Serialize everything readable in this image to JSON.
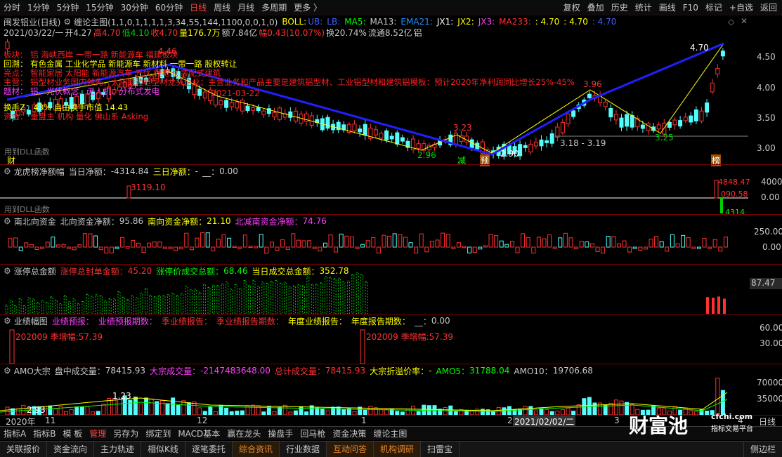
{
  "toolbar": {
    "periods": [
      "分时",
      "1分钟",
      "5分钟",
      "15分钟",
      "30分钟",
      "60分钟",
      "日线",
      "周线",
      "月线",
      "多周期",
      "更多 〉"
    ],
    "active_period": "日线",
    "right_items": [
      "复权",
      "叠加",
      "历史",
      "统计",
      "画线",
      "F10",
      "标记",
      "+自选",
      "返回"
    ]
  },
  "main": {
    "stock_title": "闽发铝业(日线)",
    "indicator": "缠论主图(1,1,0,1,1,1,1,3,34,55,144,1100,0,0,1,0)",
    "boll": "BOLL:",
    "ub": "UB:",
    "lb": "LB:",
    "ma5": "MA5:",
    "ma13": "MA13:",
    "ema21": "EMA21:",
    "jx1": "JX1:",
    "jx2": "JX2:",
    "jx3": "JX3:",
    "ma233": "MA233:",
    "val1": ": 4.70",
    "val2": ": 4.70",
    "val3": ": 4.70",
    "ohlc": {
      "date": "2021/03/22/一",
      "open": "开4.27",
      "high": "高4.70",
      "low": "低4.10",
      "close": "收4.70",
      "volume": "量176.7万",
      "amount": "额7.84亿",
      "amplitude": "幅0.43(10.07%)",
      "turnover": "换20.74%",
      "float": "流通8.52亿",
      "tag": "铝"
    },
    "overlay_lines": [
      "板块：  铝      海峡西岸      一带一路  新能源车  福建板块",
      "回溯：  有色金属  工业化学品  新能源车  新材料  一带一路  股权转让",
      "亮点：  智能家居  太阳能  新能源汽车  光伏  锂电池  装配式建筑",
      "主营：  铝型材业务国内领先，太阳能边框型材龙头企业；主营业务和产品主要是建筑铝型材、工业铝型材和建筑铝模板：预计2020年净利润同比增长25%-45%",
      "题材：  铝、光伏概念、无人机、分布式发电",
      "换手Z：43%  自由换手市值  14.43",
      "资金：  量盘主  机构  量化  佛山系  Asking"
    ],
    "annotation_date": "2021-03-22",
    "y_ticks": [
      "4.50",
      "4.00",
      "3.50",
      "3.00"
    ],
    "price_labels": [
      "4.70",
      "3.96",
      "3.23",
      "2.96",
      "2.90",
      "3.18 - 3.19",
      "3.25",
      "4.46"
    ],
    "markers": [
      "财",
      "减",
      "预",
      "榜"
    ],
    "dll_label": "用到DLL函数"
  },
  "panels": {
    "longhu": {
      "title": "龙虎榜净额幅",
      "l1": "当日净额：",
      "v1": "-4314.84",
      "l2": "三日净额：",
      "v2": "-",
      "l3": "__：",
      "v3": "0.00",
      "y_ticks": [
        "4000",
        "0.00"
      ],
      "labels": [
        "3119.10",
        "4848.47",
        "090.58",
        "4314."
      ]
    },
    "northbound": {
      "title": "南北向资金",
      "l1": "北向资金净额：",
      "v1": "95.86",
      "l2": "南向资金净额：",
      "v2": "21.10",
      "l3": "北减南资金净额：",
      "v3": "74.76",
      "y_ticks": [
        "250.00",
        "0.00"
      ]
    },
    "limitup": {
      "title": "涨停总金额",
      "l1": "涨停总封单金额：",
      "v1": "45.20",
      "l2": "涨停价成交总额：",
      "v2": "68.46",
      "l3": "当日成交总金额：",
      "v3": "352.78",
      "y_tick": "87.47"
    },
    "earnings": {
      "title": "业绩幅图",
      "l1": "业绩预报：",
      "l2": "业绩预报期数：",
      "l3": "季业绩报告：",
      "l4": "季业绩报告期数：",
      "l5": "年度业绩报告：",
      "l6": "年度报告期数：",
      "l7": "__：",
      "v7": "0.00",
      "y_ticks": [
        "60.00",
        "30.00"
      ],
      "labels": [
        "202009  季增幅:57.39",
        "202009  季增幅:57.39"
      ]
    },
    "amo": {
      "title": "AMO大宗",
      "l1": "盘中成交量：",
      "v1": "78415.93",
      "l2": "大宗成交量：",
      "v2": "-2147483648.00",
      "l3": "总计成交量：",
      "v3": "78415.93",
      "l4": "大宗折溢价率：",
      "v4": "-",
      "l5": "AMO5：",
      "v5": "31788.04",
      "l6": "AMO10：",
      "v6": "19706.68",
      "y_ticks": [
        "70000",
        "35000"
      ],
      "labels": [
        "1.23",
        "2.93"
      ]
    }
  },
  "xaxis": {
    "labels": [
      "2020年",
      "11",
      "12",
      "1",
      "2",
      "3",
      "4"
    ],
    "cursor_date": "2021/02/02/二",
    "period": "日线"
  },
  "bottom_tabs": [
    "指标A",
    "指标B",
    "模 板",
    "管理",
    "另存为",
    "绑定到",
    "MACD基本",
    "赢在龙头",
    "操盘手",
    "回马枪",
    "资金决策",
    "缠论主图"
  ],
  "active_tab": "管理",
  "bottom_nav": [
    "关联报价",
    "资金流向",
    "主力轨迹",
    "相似K线",
    "逐笔委托",
    "综合资讯",
    "行业数据",
    "互动问答",
    "机构调研",
    "扫雷宝"
  ],
  "active_nav": [
    "综合资讯",
    "互动问答",
    "机构调研"
  ],
  "nav_right": "侧边栏",
  "watermark": {
    "brand": "财富池",
    "site": "cfchi.com",
    "slogan": "指标交易平台"
  },
  "colors": {
    "up": "#ff3232",
    "down": "#54fcfc",
    "zigzag": "#ffff00",
    "trend": "#2020ff",
    "accent": "#e88a2c"
  }
}
